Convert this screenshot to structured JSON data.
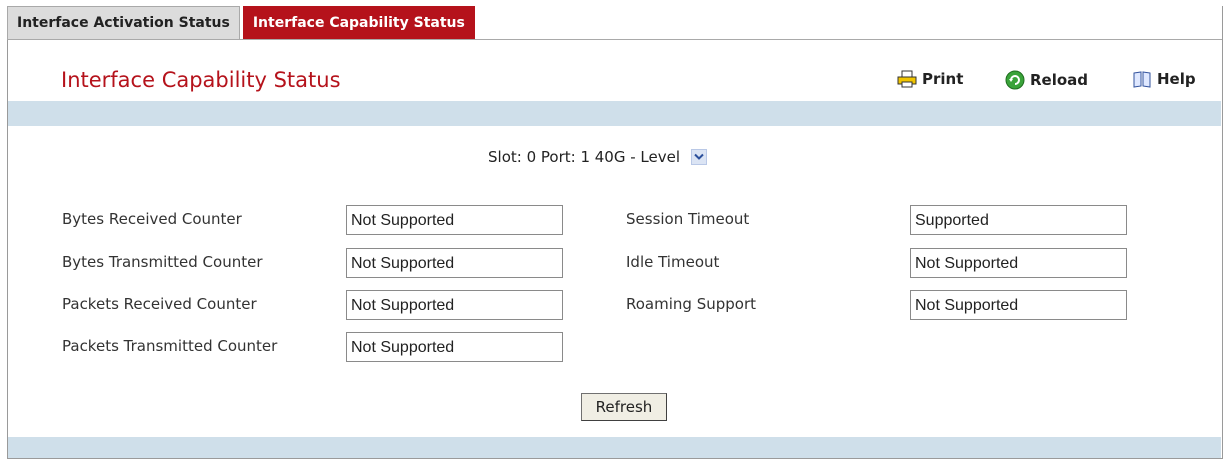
{
  "tabs": [
    {
      "label": "Interface Activation Status",
      "active": false
    },
    {
      "label": "Interface Capability Status",
      "active": true
    }
  ],
  "page": {
    "title": "Interface Capability Status"
  },
  "toolbar": {
    "print_label": "Print",
    "reload_label": "Reload",
    "help_label": "Help"
  },
  "selector": {
    "value": "Slot: 0 Port: 1 40G - Level"
  },
  "fields": {
    "bytes_received": {
      "label": "Bytes Received Counter",
      "value": "Not Supported"
    },
    "bytes_transmitted": {
      "label": "Bytes Transmitted Counter",
      "value": "Not Supported"
    },
    "packets_received": {
      "label": "Packets Received Counter",
      "value": "Not Supported"
    },
    "packets_transmitted": {
      "label": "Packets Transmitted Counter",
      "value": "Not Supported"
    },
    "session_timeout": {
      "label": "Session Timeout",
      "value": "Supported"
    },
    "idle_timeout": {
      "label": "Idle Timeout",
      "value": "Not Supported"
    },
    "roaming_support": {
      "label": "Roaming Support",
      "value": "Not Supported"
    }
  },
  "buttons": {
    "refresh_label": "Refresh"
  },
  "colors": {
    "accent": "#b5121b",
    "band": "#cfdfea"
  }
}
